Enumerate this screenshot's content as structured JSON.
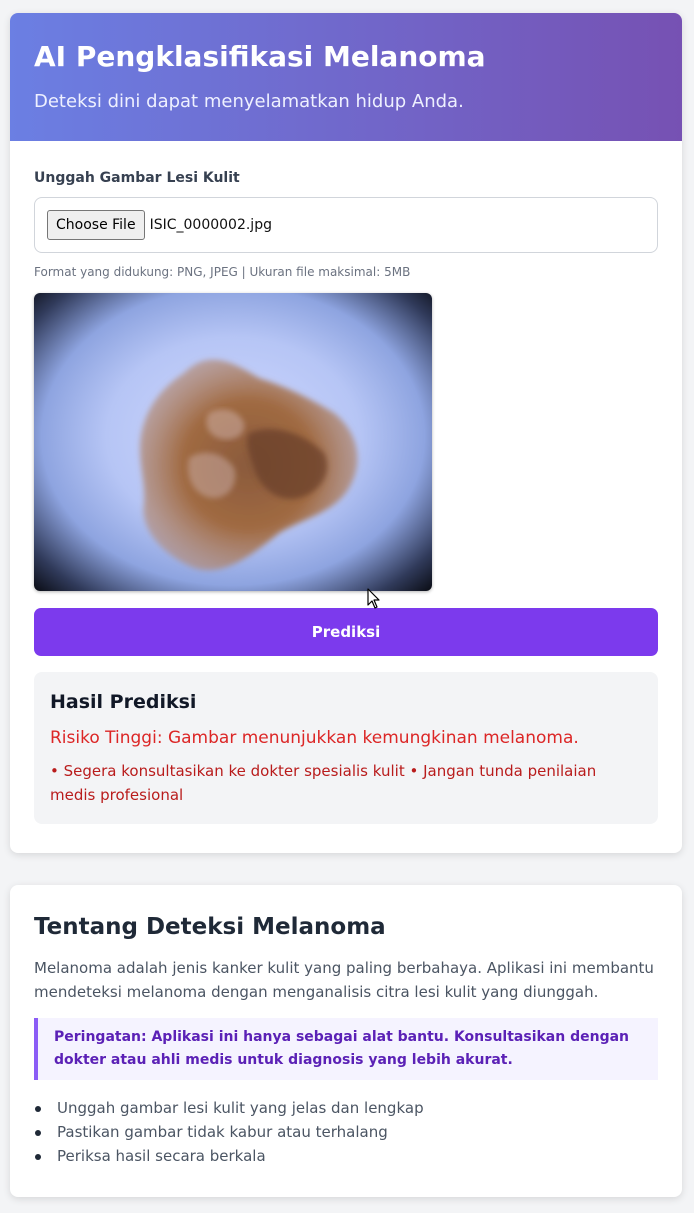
{
  "header": {
    "title": "AI Pengklasifikasi Melanoma",
    "subtitle": "Deteksi dini dapat menyelamatkan hidup Anda.",
    "gradient_start": "#6b7fe3",
    "gradient_end": "#7651b3"
  },
  "upload": {
    "label": "Unggah Gambar Lesi Kulit",
    "choose_button": "Choose File",
    "file_name": "ISIC_0000002.jpg",
    "hint": "Format yang didukung: PNG, JPEG | Ukuran file maksimal: 5MB"
  },
  "preview": {
    "icon": "skin-lesion-image"
  },
  "predict_button": {
    "label": "Prediksi",
    "color": "#7c3aed"
  },
  "result": {
    "title": "Hasil Prediksi",
    "risk_text": "Risiko Tinggi: Gambar menunjukkan kemungkinan melanoma.",
    "advice": "• Segera konsultasikan ke dokter spesialis kulit • Jangan tunda penilaian medis profesional",
    "risk_color": "#dc2626"
  },
  "about": {
    "title": "Tentang Deteksi Melanoma",
    "description": "Melanoma adalah jenis kanker kulit yang paling berbahaya. Aplikasi ini membantu mendeteksi melanoma dengan menganalisis citra lesi kulit yang diunggah.",
    "warning": "Peringatan: Aplikasi ini hanya sebagai alat bantu. Konsultasikan dengan dokter atau ahli medis untuk diagnosis yang lebih akurat.",
    "tips": [
      "Unggah gambar lesi kulit yang jelas dan lengkap",
      "Pastikan gambar tidak kabur atau terhalang",
      "Periksa hasil secara berkala"
    ]
  }
}
